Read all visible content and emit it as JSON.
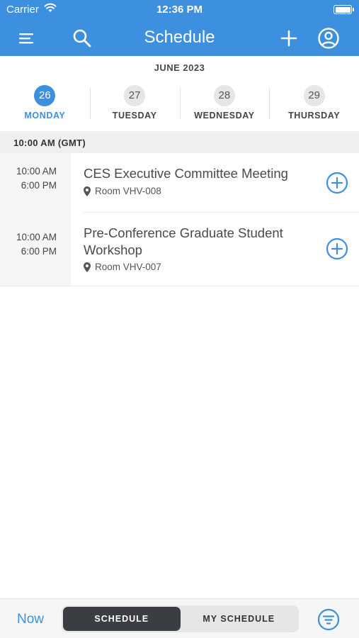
{
  "status_bar": {
    "carrier": "Carrier",
    "time": "12:36 PM"
  },
  "nav": {
    "title": "Schedule",
    "icons": [
      "menu-icon",
      "search-icon",
      "plus-icon",
      "user-circle-icon"
    ]
  },
  "calendar": {
    "month": "JUNE 2023",
    "days": [
      {
        "num": "26",
        "name": "MONDAY",
        "selected": true
      },
      {
        "num": "27",
        "name": "TUESDAY",
        "selected": false
      },
      {
        "num": "28",
        "name": "WEDNESDAY",
        "selected": false
      },
      {
        "num": "29",
        "name": "THURSDAY",
        "selected": false
      }
    ]
  },
  "section": {
    "header": "10:00 AM (GMT)"
  },
  "sessions": [
    {
      "start": "10:00 AM",
      "end": "6:00 PM",
      "title_lines": [
        "CES Executive Committee Meeting"
      ],
      "location": "Room VHV-008"
    },
    {
      "start": "10:00 AM",
      "end": "6:00 PM",
      "title_lines": [
        "Pre-Conference Graduate Student",
        "Workshop"
      ],
      "location": "Room VHV-007"
    }
  ],
  "tab_bar": {
    "now_label": "Now",
    "segments": [
      {
        "label": "SCHEDULE",
        "active": true
      },
      {
        "label": "MY SCHEDULE",
        "active": false
      }
    ]
  },
  "colors": {
    "accent": "#3d8fe0",
    "segment_active": "#3a3d42"
  }
}
